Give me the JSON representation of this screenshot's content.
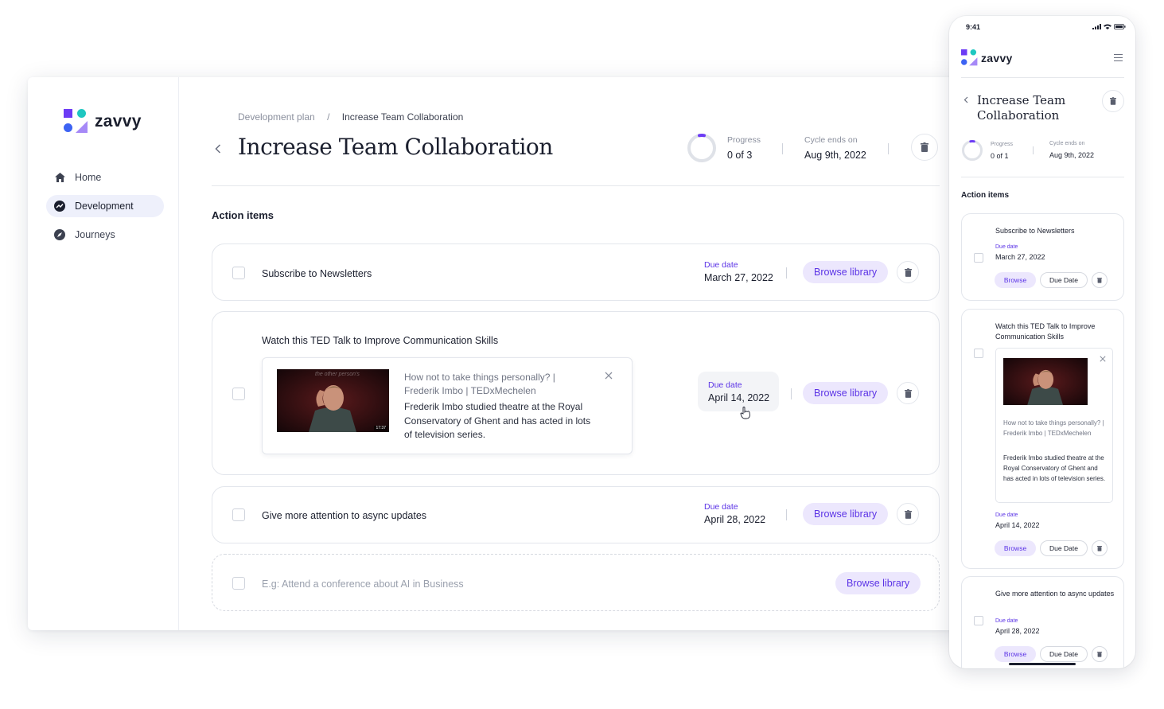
{
  "brand": {
    "name": "zavvy",
    "colors": {
      "primary": "#5b33e6",
      "teal": "#1fc7c1",
      "blue": "#3d63f3",
      "lavender": "#a689f7"
    }
  },
  "sidebar": {
    "items": [
      {
        "label": "Home",
        "icon": "home-icon",
        "active": false
      },
      {
        "label": "Development",
        "icon": "trending-icon",
        "active": true
      },
      {
        "label": "Journeys",
        "icon": "compass-icon",
        "active": false
      }
    ]
  },
  "breadcrumb": {
    "parent": "Development plan",
    "separator": "/",
    "current": "Increase Team Collaboration"
  },
  "header": {
    "title": "Increase Team Collaboration",
    "progress_label": "Progress",
    "progress_value": "0 of 3",
    "progress_fraction": 0,
    "cycle_label": "Cycle ends on",
    "cycle_value": "Aug 9th, 2022"
  },
  "section_title": "Action items",
  "action_items": [
    {
      "title": "Subscribe to Newsletters",
      "due_label": "Due date",
      "due_value": "March 27, 2022",
      "browse_label": "Browse library"
    },
    {
      "title": "Watch this TED Talk to Improve Communication Skills",
      "due_label": "Due date",
      "due_value": "April 14, 2022",
      "browse_label": "Browse library",
      "video": {
        "title": "How not to take things personally? | Frederik Imbo | TEDxMechelen",
        "description": "Frederik Imbo studied theatre at the Royal Conservatory of Ghent and has acted in lots of television series.",
        "thumb_caption": "the other person's",
        "duration": "17:37"
      }
    },
    {
      "title": "Give more attention to async updates",
      "due_label": "Due date",
      "due_value": "April 28, 2022",
      "browse_label": "Browse library"
    }
  ],
  "new_item": {
    "placeholder": "E.g: Attend a conference about AI in Business",
    "browse_label": "Browse library"
  },
  "mobile": {
    "time": "9:41",
    "title": "Increase Team Collaboration",
    "progress_label": "Progress",
    "progress_value": "0 of 1",
    "cycle_label": "Cycle ends on",
    "cycle_value": "Aug 9th, 2022",
    "section_title": "Action items",
    "browse_label": "Browse",
    "due_button_label": "Due Date",
    "items": [
      {
        "title": "Subscribe to Newsletters",
        "due_label": "Due date",
        "due_value": "March 27, 2022"
      },
      {
        "title": "Watch this TED Talk to Improve Communication Skills",
        "due_label": "Due date",
        "due_value": "April 14, 2022"
      },
      {
        "title": "Give more attention to async updates",
        "due_label": "Due date",
        "due_value": "April 28, 2022"
      }
    ]
  }
}
